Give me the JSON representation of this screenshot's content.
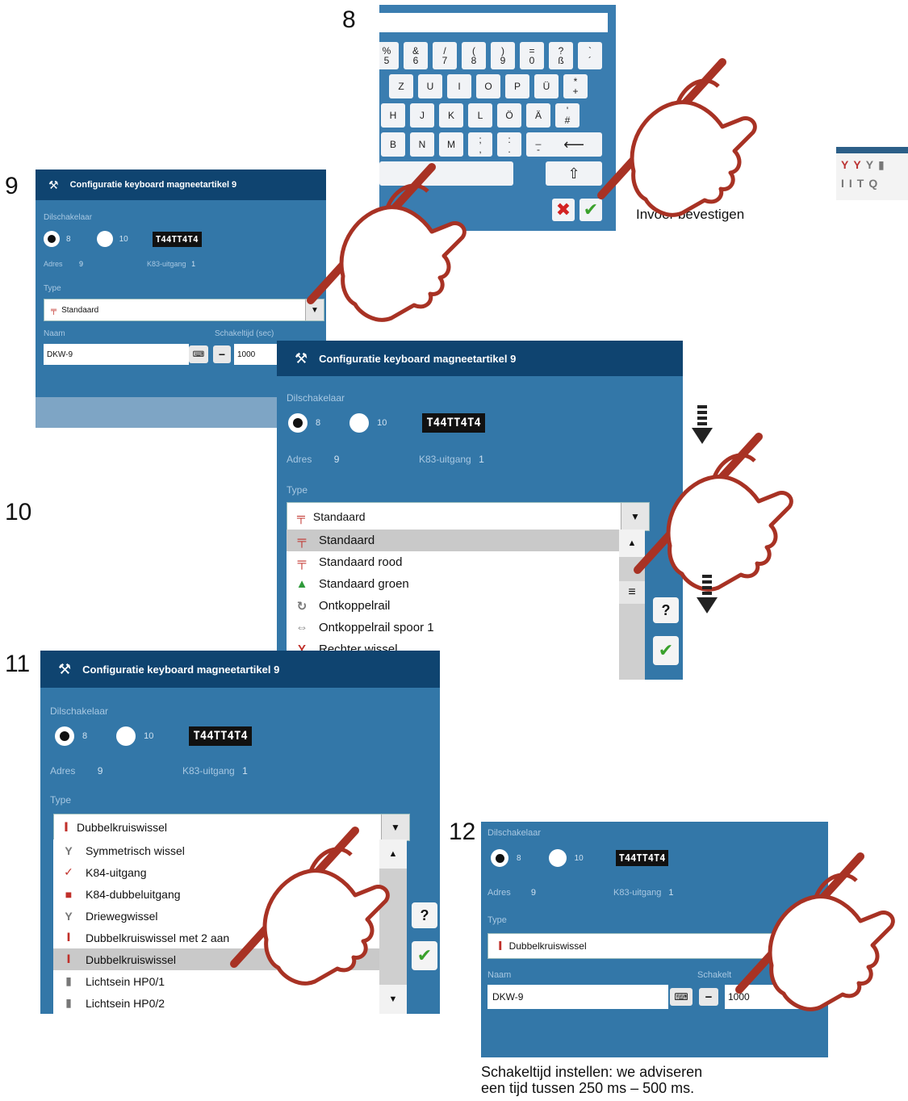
{
  "steps": {
    "s8": "8",
    "s9": "9",
    "s10": "10",
    "s11": "11",
    "s12": "12"
  },
  "keyboard": {
    "row1": [
      "%\n5",
      "&\n6",
      "/\n7",
      "(\n8",
      ")\n9",
      "=\n0",
      "?\nß",
      "`\n´"
    ],
    "row2": [
      "Z",
      "U",
      "I",
      "O",
      "P",
      "Ü",
      "*\n+"
    ],
    "row3": [
      "H",
      "J",
      "K",
      "L",
      "Ö",
      "Ä",
      "'\n#"
    ],
    "row4": [
      "B",
      "N",
      "M",
      ";\n,",
      ":\n.",
      "_\n-"
    ],
    "backspace_icon": "backspace-arrow-icon",
    "shift_icon": "shift-arrow-icon",
    "cancel_icon": "red-x-icon",
    "ok_icon": "green-check-icon",
    "caption": "Invoer bevestigen"
  },
  "config": {
    "title": "Configuratie keyboard magneetartikel 9",
    "dip_label": "Dilschakelaar",
    "radio_8": "8",
    "radio_10": "10",
    "dip_graphic": "T44TT4T4",
    "adres_label": "Adres",
    "adres_value": "9",
    "k83_label": "K83-uitgang",
    "k83_value": "1",
    "type_label": "Type",
    "naam_label": "Naam",
    "schakeltijd_label": "Schakeltijd (sec)",
    "naam_value": "DKW-9",
    "schakeltijd_value": "1000",
    "minus": "−",
    "plus": "+"
  },
  "panel9": {
    "type_selected": "Standaard"
  },
  "panel10": {
    "type_selected": "Standaard",
    "list": [
      "Standaard",
      "Standaard rood",
      "Standaard groen",
      "Ontkoppelrail",
      "Ontkoppelrail spoor 1",
      "Rechter wissel"
    ],
    "help": "?"
  },
  "panel11": {
    "type_selected": "Dubbelkruiswissel",
    "list": [
      "Symmetrisch wissel",
      "K84-uitgang",
      "K84-dubbeluitgang",
      "Driewegwissel",
      "Dubbelkruiswissel met 2 aan",
      "Dubbelkruiswissel",
      "Lichtsein HP0/1",
      "Lichtsein HP0/2"
    ],
    "help": "?"
  },
  "panel12": {
    "type_selected": "Dubbelkruiswissel",
    "schakeltijd_label_visible": "Schakelt",
    "caption_line1": "Schakeltijd instellen:  we adviseren",
    "caption_line2": "een tijd tussen 250 ms – 500 ms."
  },
  "icons": {
    "hand": "hand-with-stylus-icon",
    "arrow_down": "dashed-arrow-down-icon"
  },
  "colors": {
    "panel_bg": "#3377a8",
    "header_bg": "#0f4470",
    "stylus": "#a83224"
  }
}
